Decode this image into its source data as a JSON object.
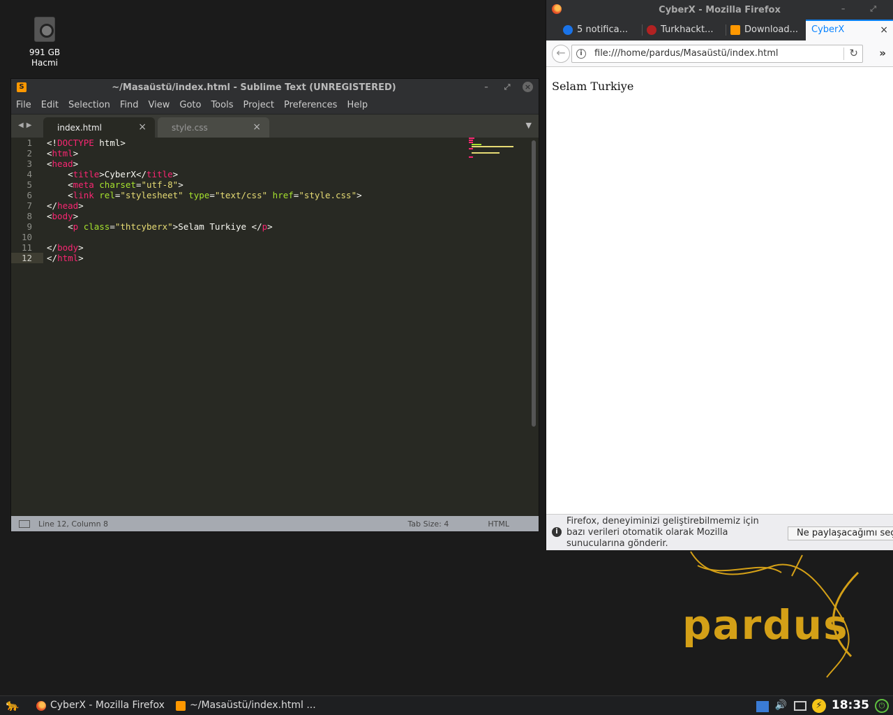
{
  "desktop": {
    "drive_label_line1": "991 GB",
    "drive_label_line2": "Hacmi"
  },
  "wallpaper": {
    "logo_text": "pardus",
    "logo_color": "#d4a017"
  },
  "sublime": {
    "title": "~/Masaüstü/index.html - Sublime Text (UNREGISTERED)",
    "menu": [
      "File",
      "Edit",
      "Selection",
      "Find",
      "View",
      "Goto",
      "Tools",
      "Project",
      "Preferences",
      "Help"
    ],
    "tabs": [
      {
        "label": "index.html",
        "active": true
      },
      {
        "label": "style.css",
        "active": false
      }
    ],
    "line_numbers": [
      "1",
      "2",
      "3",
      "4",
      "5",
      "6",
      "7",
      "8",
      "9",
      "10",
      "11",
      "12"
    ],
    "code_lines": [
      "<!DOCTYPE html>",
      "<html>",
      "<head>",
      "    <title>CyberX</title>",
      "    <meta charset=\"utf-8\">",
      "    <link rel=\"stylesheet\" type=\"text/css\" href=\"style.css\">",
      "</head>",
      "<body>",
      "    <p class=\"thtcyberx\">Selam Turkiye </p>",
      "",
      "</body>",
      "</html>"
    ],
    "status": {
      "position": "Line 12, Column 8",
      "tab_size": "Tab Size: 4",
      "syntax": "HTML"
    }
  },
  "firefox": {
    "title": "CyberX - Mozilla Firefox",
    "tabs": [
      {
        "label": "5 notifica...",
        "icon": "notification-icon",
        "color": "#1a73e8"
      },
      {
        "label": "Turkhackt...",
        "icon": "turkhackteam-icon",
        "color": "#b22222"
      },
      {
        "label": "Download...",
        "icon": "sublime-icon",
        "color": "#ff9800"
      },
      {
        "label": "CyberX",
        "active": true
      }
    ],
    "url": "file:///home/pardus/Masaüstü/index.html",
    "page_text": "Selam Turkiye",
    "notification": {
      "message": "Firefox, deneyiminizi geliştirebilmemiz için bazı verileri otomatik olarak Mozilla sunucularına gönderir.",
      "button": "Ne paylaşacağımı seç"
    }
  },
  "taskbar": {
    "items": [
      {
        "label": "CyberX - Mozilla Firefox",
        "icon": "firefox-icon"
      },
      {
        "label": "~/Masaüstü/index.html ...",
        "icon": "sublime-icon"
      }
    ],
    "clock": "18:35"
  }
}
